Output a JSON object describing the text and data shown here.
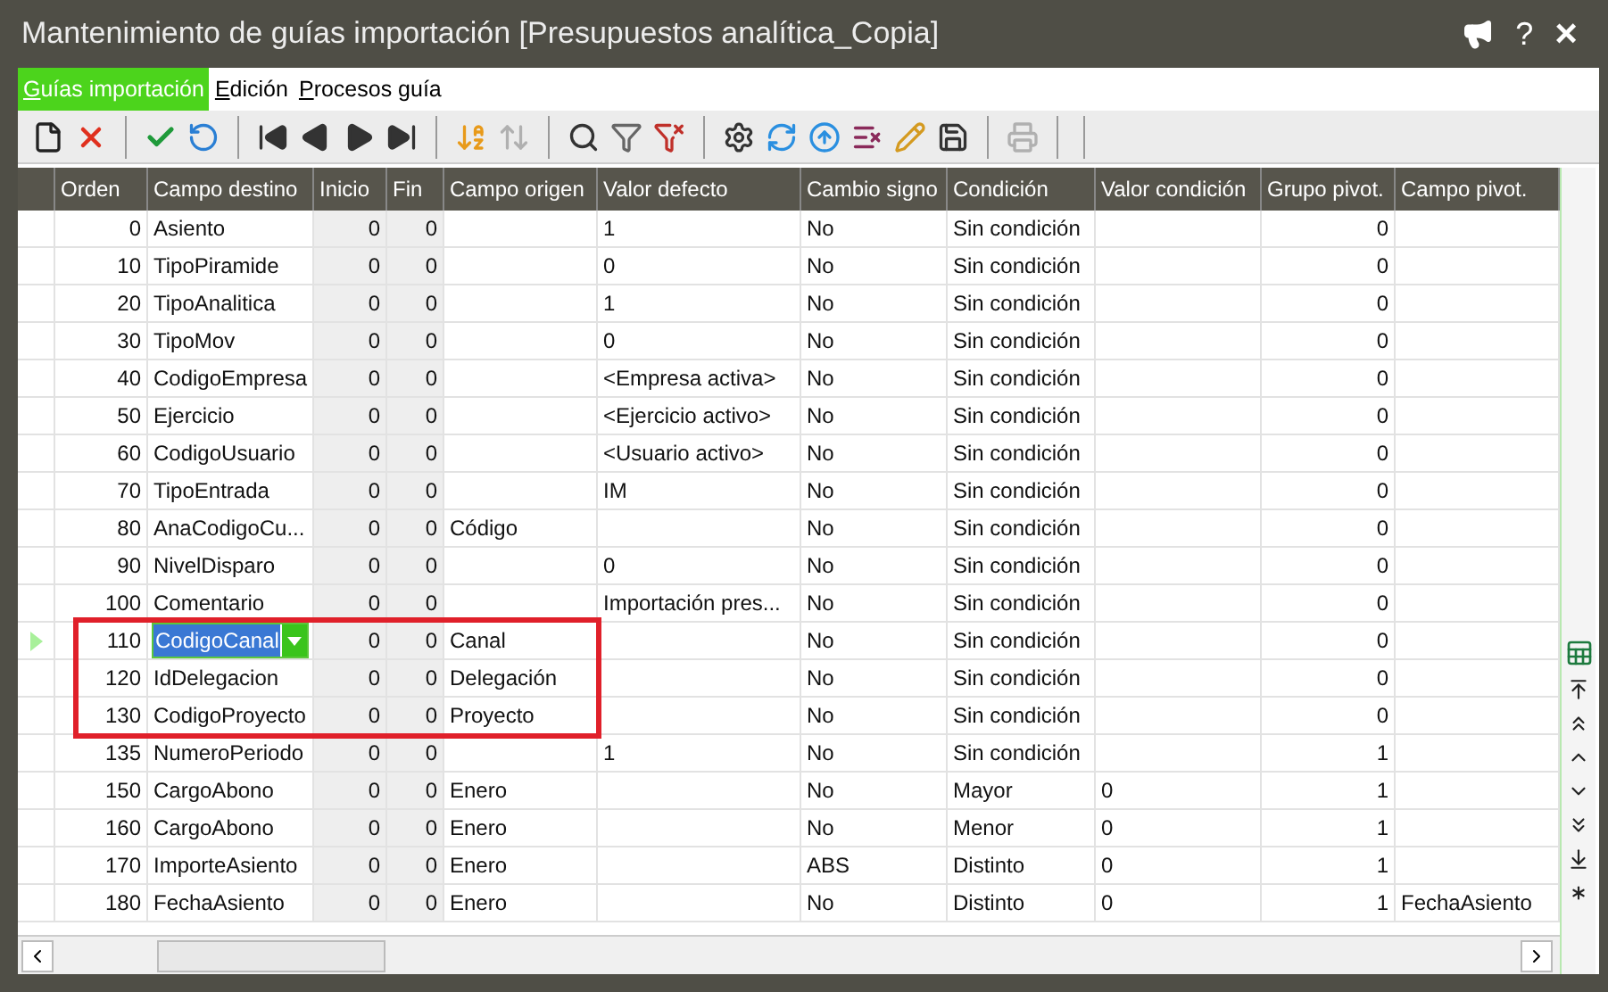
{
  "window": {
    "title": "Mantenimiento de guías importación [Presupuestos analítica_Copia]",
    "help": "?",
    "close": "×"
  },
  "menu": [
    {
      "label": "Guías importación",
      "selected": true
    },
    {
      "label": "Edición",
      "selected": false
    },
    {
      "label": "Procesos guía",
      "selected": false
    }
  ],
  "toolbar": [
    {
      "kind": "new",
      "disabled": false
    },
    {
      "kind": "delete",
      "disabled": false
    },
    {
      "kind": "separator"
    },
    {
      "kind": "accept",
      "disabled": false
    },
    {
      "kind": "undo",
      "disabled": false
    },
    {
      "kind": "separator"
    },
    {
      "kind": "first",
      "disabled": false
    },
    {
      "kind": "prev",
      "disabled": false
    },
    {
      "kind": "next",
      "disabled": false
    },
    {
      "kind": "last",
      "disabled": false
    },
    {
      "kind": "separator"
    },
    {
      "kind": "sort",
      "disabled": false
    },
    {
      "kind": "sort2",
      "disabled": true
    },
    {
      "kind": "separator"
    },
    {
      "kind": "search",
      "disabled": false
    },
    {
      "kind": "filter",
      "disabled": false
    },
    {
      "kind": "filterclear",
      "disabled": false
    },
    {
      "kind": "separator"
    },
    {
      "kind": "settings",
      "disabled": false
    },
    {
      "kind": "refresh",
      "disabled": false
    },
    {
      "kind": "upload",
      "disabled": false
    },
    {
      "kind": "deletelines",
      "disabled": false
    },
    {
      "kind": "edit",
      "disabled": false
    },
    {
      "kind": "save",
      "disabled": false
    },
    {
      "kind": "separator"
    },
    {
      "kind": "print",
      "disabled": true
    },
    {
      "kind": "separator"
    },
    {
      "kind": "separator"
    }
  ],
  "table": {
    "columns": [
      {
        "label": "Orden",
        "kind": "number",
        "readonly": false
      },
      {
        "label": "Campo destino",
        "kind": "lookup",
        "readonly": false
      },
      {
        "label": "Inicio",
        "kind": "number",
        "readonly": true
      },
      {
        "label": "Fin",
        "kind": "number",
        "readonly": true
      },
      {
        "label": "Campo origen",
        "kind": "text",
        "readonly": false
      },
      {
        "label": "Valor defecto",
        "kind": "text",
        "readonly": false
      },
      {
        "label": "Cambio signo",
        "kind": "text",
        "readonly": false
      },
      {
        "label": "Condición",
        "kind": "text",
        "readonly": false
      },
      {
        "label": "Valor condición",
        "kind": "text",
        "readonly": false
      },
      {
        "label": "Grupo pivot.",
        "kind": "number",
        "readonly": false
      },
      {
        "label": "Campo pivot.",
        "kind": "text",
        "readonly": false
      }
    ],
    "rows": [
      {
        "selected": false,
        "outlined": false,
        "cells": [
          "0",
          "Asiento",
          "0",
          "0",
          "",
          "1",
          "No",
          "Sin condición",
          "",
          "0",
          ""
        ]
      },
      {
        "selected": false,
        "outlined": false,
        "cells": [
          "10",
          "TipoPiramide",
          "0",
          "0",
          "",
          "0",
          "No",
          "Sin condición",
          "",
          "0",
          ""
        ]
      },
      {
        "selected": false,
        "outlined": false,
        "cells": [
          "20",
          "TipoAnalitica",
          "0",
          "0",
          "",
          "1",
          "No",
          "Sin condición",
          "",
          "0",
          ""
        ]
      },
      {
        "selected": false,
        "outlined": false,
        "cells": [
          "30",
          "TipoMov",
          "0",
          "0",
          "",
          "0",
          "No",
          "Sin condición",
          "",
          "0",
          ""
        ]
      },
      {
        "selected": false,
        "outlined": false,
        "cells": [
          "40",
          "CodigoEmpresa",
          "0",
          "0",
          "",
          "<Empresa activa>",
          "No",
          "Sin condición",
          "",
          "0",
          ""
        ]
      },
      {
        "selected": false,
        "outlined": false,
        "cells": [
          "50",
          "Ejercicio",
          "0",
          "0",
          "",
          "<Ejercicio activo>",
          "No",
          "Sin condición",
          "",
          "0",
          ""
        ]
      },
      {
        "selected": false,
        "outlined": false,
        "cells": [
          "60",
          "CodigoUsuario",
          "0",
          "0",
          "",
          "<Usuario activo>",
          "No",
          "Sin condición",
          "",
          "0",
          ""
        ]
      },
      {
        "selected": false,
        "outlined": false,
        "cells": [
          "70",
          "TipoEntrada",
          "0",
          "0",
          "",
          "IM",
          "No",
          "Sin condición",
          "",
          "0",
          ""
        ]
      },
      {
        "selected": false,
        "outlined": false,
        "cells": [
          "80",
          "AnaCodigoCu...",
          "0",
          "0",
          "Código",
          "",
          "No",
          "Sin condición",
          "",
          "0",
          ""
        ]
      },
      {
        "selected": false,
        "outlined": false,
        "cells": [
          "90",
          "NivelDisparo",
          "0",
          "0",
          "",
          "0",
          "No",
          "Sin condición",
          "",
          "0",
          ""
        ]
      },
      {
        "selected": false,
        "outlined": false,
        "cells": [
          "100",
          "Comentario",
          "0",
          "0",
          "",
          "Importación pres...",
          "No",
          "Sin condición",
          "",
          "0",
          ""
        ]
      },
      {
        "selected": true,
        "outlined": true,
        "cells": [
          "110",
          "CodigoCanal",
          "0",
          "0",
          "Canal",
          "",
          "No",
          "Sin condición",
          "",
          "0",
          ""
        ]
      },
      {
        "selected": false,
        "outlined": true,
        "cells": [
          "120",
          "IdDelegacion",
          "0",
          "0",
          "Delegación",
          "",
          "No",
          "Sin condición",
          "",
          "0",
          ""
        ]
      },
      {
        "selected": false,
        "outlined": true,
        "cells": [
          "130",
          "CodigoProyecto",
          "0",
          "0",
          "Proyecto",
          "",
          "No",
          "Sin condición",
          "",
          "0",
          ""
        ]
      },
      {
        "selected": false,
        "outlined": false,
        "cells": [
          "135",
          "NumeroPeriodo",
          "0",
          "0",
          "",
          "1",
          "No",
          "Sin condición",
          "",
          "1",
          ""
        ]
      },
      {
        "selected": false,
        "outlined": false,
        "cells": [
          "150",
          "CargoAbono",
          "0",
          "0",
          "Enero",
          "",
          "No",
          "Mayor",
          "0",
          "1",
          ""
        ]
      },
      {
        "selected": false,
        "outlined": false,
        "cells": [
          "160",
          "CargoAbono",
          "0",
          "0",
          "Enero",
          "",
          "No",
          "Menor",
          "0",
          "1",
          ""
        ]
      },
      {
        "selected": false,
        "outlined": false,
        "cells": [
          "170",
          "ImporteAsiento",
          "0",
          "0",
          "Enero",
          "",
          "ABS",
          "Distinto",
          "0",
          "1",
          ""
        ]
      },
      {
        "selected": false,
        "outlined": false,
        "cells": [
          "180",
          "FechaAsiento",
          "0",
          "0",
          "Enero",
          "",
          "No",
          "Distinto",
          "0",
          "1",
          "FechaAsiento"
        ]
      }
    ]
  }
}
